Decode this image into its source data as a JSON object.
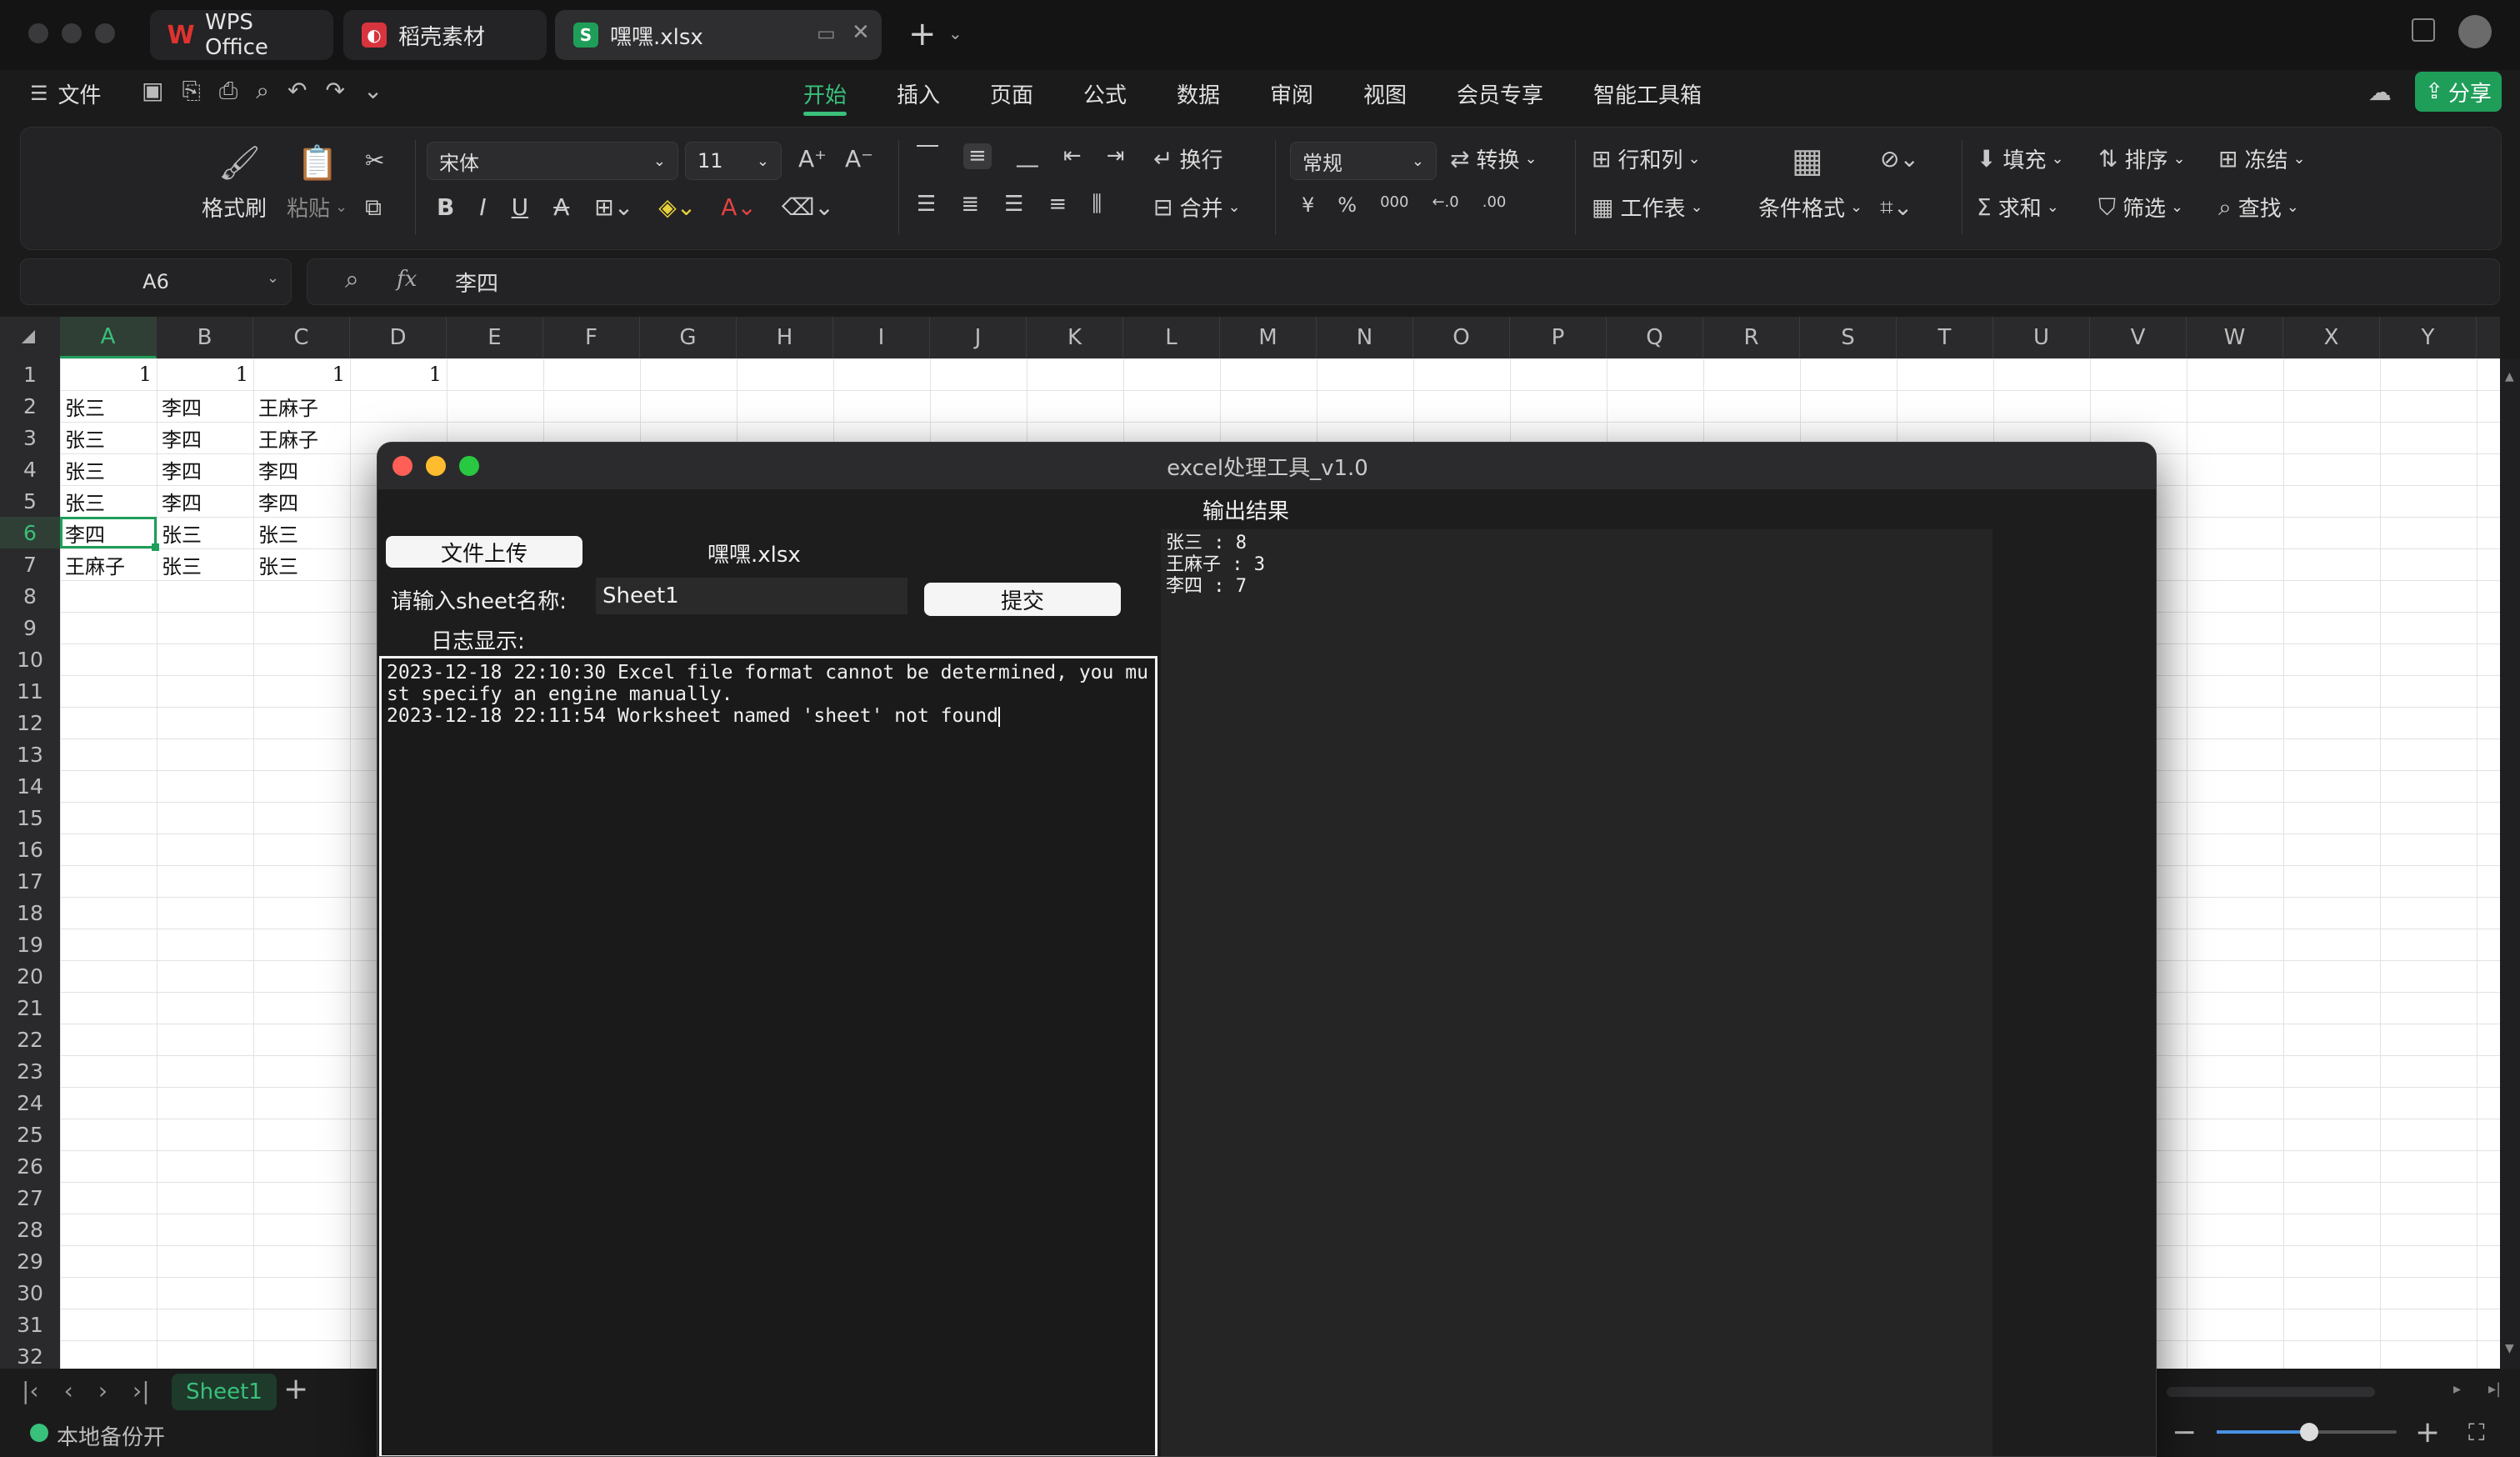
{
  "tabs": [
    {
      "label": "WPS Office",
      "icon": "wps-logo-icon"
    },
    {
      "label": "稻壳素材",
      "icon": "docer-icon"
    },
    {
      "label": "嘿嘿.xlsx",
      "icon": "spreadsheet-s-icon"
    }
  ],
  "menu": {
    "file": "文件",
    "items": [
      "开始",
      "插入",
      "页面",
      "公式",
      "数据",
      "审阅",
      "视图",
      "会员专享",
      "智能工具箱"
    ],
    "active": "开始",
    "share": "分享"
  },
  "ribbon": {
    "format_painter": "格式刷",
    "paste": "粘贴",
    "font": "宋体",
    "font_size": "11",
    "wrap": "换行",
    "merge": "合并",
    "number_format": "常规",
    "convert": "转换",
    "rows_cols": "行和列",
    "worksheet": "工作表",
    "cond_format": "条件格式",
    "fill": "填充",
    "sort": "排序",
    "freeze": "冻结",
    "sum": "求和",
    "filter": "筛选",
    "find": "查找",
    "currency": "¥",
    "percent": "%",
    "thousands": "000"
  },
  "formula": {
    "cell_ref": "A6",
    "fx": "fx",
    "value": "李四"
  },
  "sheet": {
    "columns": [
      "A",
      "B",
      "C",
      "D",
      "E",
      "F",
      "G",
      "H",
      "I",
      "J",
      "K",
      "L",
      "M",
      "N",
      "O",
      "P",
      "Q",
      "R",
      "S",
      "T",
      "U",
      "V",
      "W",
      "X",
      "Y"
    ],
    "rows": [
      "1",
      "2",
      "3",
      "4",
      "5",
      "6",
      "7",
      "8",
      "9",
      "10",
      "11",
      "12",
      "13",
      "14",
      "15",
      "16",
      "17",
      "18",
      "19",
      "20",
      "21",
      "22",
      "23",
      "24",
      "25",
      "26",
      "27",
      "28",
      "29",
      "30",
      "31",
      "32"
    ],
    "data": [
      [
        "1",
        "1",
        "1",
        "1"
      ],
      [
        "张三",
        "李四",
        "王麻子",
        ""
      ],
      [
        "张三",
        "李四",
        "王麻子",
        ""
      ],
      [
        "张三",
        "李四",
        "李四",
        ""
      ],
      [
        "张三",
        "李四",
        "李四",
        ""
      ],
      [
        "李四",
        "张三",
        "张三",
        ""
      ],
      [
        "王麻子",
        "张三",
        "张三",
        ""
      ]
    ],
    "sheet_tab": "Sheet1",
    "status": "本地备份开"
  },
  "dialog": {
    "title": "excel处理工具_v1.0",
    "upload_button": "文件上传",
    "file_name": "嘿嘿.xlsx",
    "sheet_label": "请输入sheet名称:",
    "sheet_value": "Sheet1",
    "submit_button": "提交",
    "log_label": "日志显示:",
    "log_text": "2023-12-18 22:10:30 Excel file format cannot be determined, you must specify an engine manually.\n2023-12-18 22:11:54 Worksheet named 'sheet' not found",
    "output_label": "输出结果",
    "output_text": "张三 : 8\n王麻子 : 3\n李四 : 7"
  },
  "colors": {
    "accent": "#39c07a",
    "share_bg": "#1f9e5a"
  }
}
